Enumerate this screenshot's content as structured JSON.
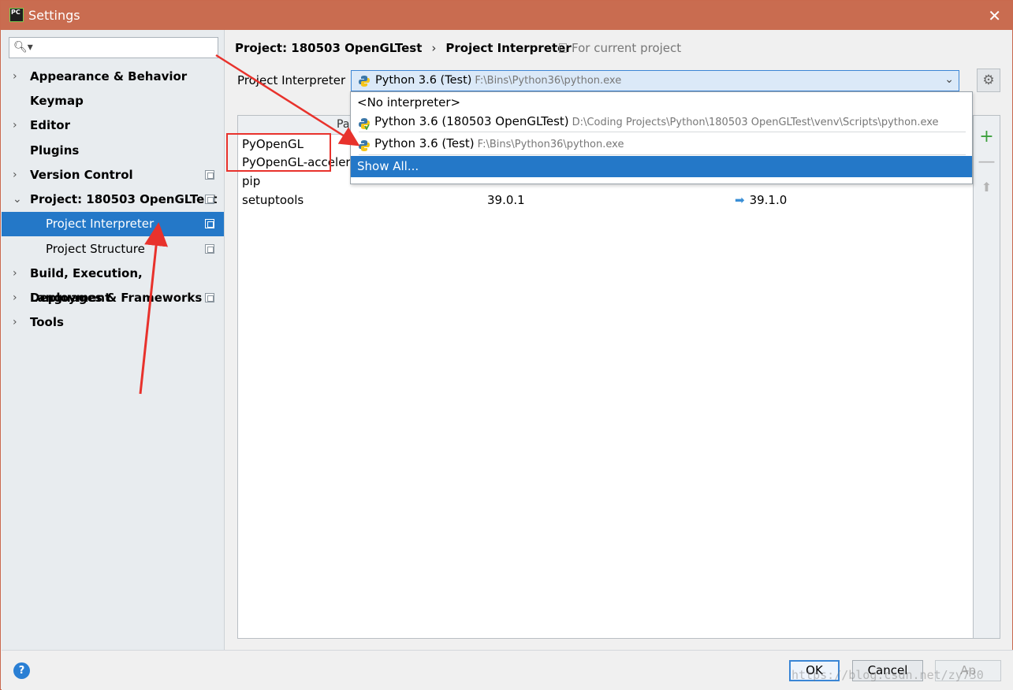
{
  "window": {
    "title": "Settings",
    "app_icon": "PC"
  },
  "search": {
    "placeholder": ""
  },
  "sidebar": {
    "items": [
      {
        "label": "Appearance & Behavior",
        "expandable": true,
        "copy_icon": false
      },
      {
        "label": "Keymap",
        "expandable": false,
        "copy_icon": false
      },
      {
        "label": "Editor",
        "expandable": true,
        "copy_icon": false
      },
      {
        "label": "Plugins",
        "expandable": false,
        "copy_icon": false
      },
      {
        "label": "Version Control",
        "expandable": true,
        "copy_icon": true
      },
      {
        "label": "Project: 180503 OpenGLTest",
        "expandable": true,
        "expanded": true,
        "copy_icon": true
      },
      {
        "label": "Project Interpreter",
        "selected": true,
        "copy_icon": true
      },
      {
        "label": "Project Structure",
        "copy_icon": true
      },
      {
        "label": "Build, Execution, Deployment",
        "expandable": true,
        "copy_icon": false
      },
      {
        "label": "Languages & Frameworks",
        "expandable": true,
        "copy_icon": true
      },
      {
        "label": "Tools",
        "expandable": true,
        "copy_icon": false
      }
    ]
  },
  "breadcrumb": {
    "project": "Project: 180503 OpenGLTest",
    "page": "Project Interpreter",
    "separator": "›"
  },
  "for_current_project": "For current project",
  "interpreter": {
    "label": "Project Interpreter",
    "selected_name": "Python 3.6 (Test)",
    "selected_path": "F:\\Bins\\Python36\\python.exe"
  },
  "table": {
    "header_partial": "Pa",
    "rows": [
      {
        "package": "PyOpenGL",
        "version": "",
        "latest": ""
      },
      {
        "package": "PyOpenGL-accelera",
        "version": "",
        "latest": ""
      },
      {
        "package": "pip",
        "version": "",
        "latest": ""
      },
      {
        "package": "setuptools",
        "version": "39.0.1",
        "latest": "39.1.0"
      }
    ]
  },
  "dropdown": {
    "no_interpreter": "<No interpreter>",
    "options": [
      {
        "name": "Python 3.6 (180503 OpenGLTest)",
        "path": "D:\\Coding Projects\\Python\\180503 OpenGLTest\\venv\\Scripts\\python.exe"
      },
      {
        "name": "Python 3.6 (Test)",
        "path": "F:\\Bins\\Python36\\python.exe"
      }
    ],
    "show_all": "Show All..."
  },
  "buttons": {
    "ok": "OK",
    "cancel": "Cancel",
    "apply": "Ap"
  },
  "help": "?",
  "watermark": "https://blog.csdn.net/zy730",
  "colors": {
    "titlebar": "#c96c50",
    "selection": "#2478c8",
    "annotation_red": "#e8322c",
    "add_green": "#3ca03c"
  }
}
